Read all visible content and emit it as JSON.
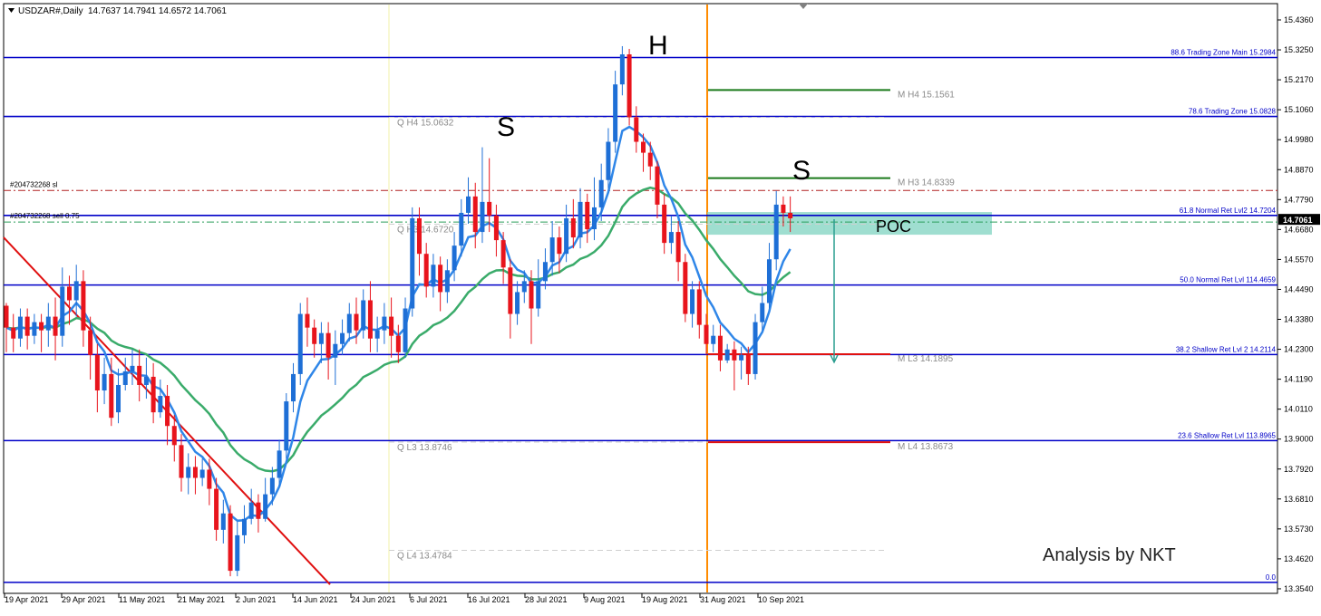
{
  "window": {
    "title": "USDZAR#,Daily",
    "ohlc": "14.7637 14.7941 14.6572 14.7061"
  },
  "annotations": {
    "watermark": "Analysis by NKT",
    "pattern_left": "S",
    "pattern_head": "H",
    "pattern_right": "S",
    "poc": "POC",
    "order_sl": "#204732268 sl",
    "order_sell": "#204732268 sell 0.75"
  },
  "colors": {
    "bull": "#1e6fd6",
    "bear": "#e8141c",
    "ma_fast": "#2f86e8",
    "ma_slow": "#3aab6a",
    "level_line": "#0000c8",
    "pivot_green": "#1a7a1a",
    "pivot_red": "#e01010",
    "vertical_marker": "#ff8c00",
    "trendline": "#e01010",
    "poc_zone": "#7fd3c0",
    "current_price_bg": "#000000"
  },
  "chart_data": {
    "type": "candlestick",
    "symbol": "USDZAR#",
    "timeframe": "Daily",
    "ylim": [
      13.354,
      15.4856
    ],
    "y_ticks": [
      "15.4360",
      "15.3250",
      "15.2170",
      "15.1060",
      "14.9980",
      "14.8870",
      "14.7790",
      "14.6680",
      "14.5570",
      "14.4490",
      "14.3380",
      "14.2300",
      "14.1190",
      "14.0110",
      "13.9000",
      "13.7920",
      "13.6810",
      "13.5730",
      "13.4620",
      "13.3540"
    ],
    "x_ticks": [
      "19 Apr 2021",
      "29 Apr 2021",
      "11 May 2021",
      "21 May 2021",
      "2 Jun 2021",
      "14 Jun 2021",
      "24 Jun 2021",
      "6 Jul 2021",
      "16 Jul 2021",
      "28 Jul 2021",
      "9 Aug 2021",
      "19 Aug 2021",
      "31 Aug 2021",
      "10 Sep 2021"
    ],
    "current_price": "14.7061",
    "fib_levels": [
      {
        "label": "88.6 Trading Zone Main 15.2984",
        "value": 15.2984
      },
      {
        "label": "78.6 Trading Zone 15.0828",
        "value": 15.0828
      },
      {
        "label": "61.8 Normal Ret Lvl2 14.7204",
        "value": 14.7204
      },
      {
        "label": "50.0 Normal Ret Lvl 114.4659",
        "value": 14.4659
      },
      {
        "label": "38.2 Shallow Ret Lvl 2 14.2114",
        "value": 14.2114
      },
      {
        "label": "23.6 Shallow Ret Lvl 113.8965",
        "value": 13.8965
      },
      {
        "label": "0.0",
        "value": 13.3776
      }
    ],
    "quarterly_pivots": [
      {
        "label": "Q  H4 15.0632",
        "value": 15.0632
      },
      {
        "label": "Q  H3 14.6720",
        "value": 14.672
      },
      {
        "label": "Q  L3 13.8746",
        "value": 13.8746
      },
      {
        "label": "Q  L4 13.4784",
        "value": 13.4784
      }
    ],
    "monthly_pivots": [
      {
        "label": "M  H4 15.1561",
        "value": 15.1561,
        "color": "green"
      },
      {
        "label": "M  H3 14.8339",
        "value": 14.8339,
        "color": "green"
      },
      {
        "label": "M  L3 14.1895",
        "value": 14.1895,
        "color": "red"
      },
      {
        "label": "M  L4 13.8673",
        "value": 13.8673,
        "color": "red"
      }
    ],
    "orders": [
      {
        "label": "#204732268 sl",
        "value": 14.8117
      },
      {
        "label": "#204732268 sell 0.75",
        "value": 14.6962
      }
    ],
    "poc_zone": [
      14.65,
      14.733
    ],
    "projection_target": 14.19,
    "candles": [
      [
        14.39,
        14.31,
        14.4,
        14.22
      ],
      [
        14.31,
        14.27,
        14.36,
        14.22
      ],
      [
        14.27,
        14.35,
        14.38,
        14.24
      ],
      [
        14.35,
        14.28,
        14.38,
        14.23
      ],
      [
        14.28,
        14.33,
        14.36,
        14.25
      ],
      [
        14.33,
        14.3,
        14.36,
        14.22
      ],
      [
        14.3,
        14.35,
        14.4,
        14.24
      ],
      [
        14.35,
        14.28,
        14.42,
        14.19
      ],
      [
        14.28,
        14.46,
        14.53,
        14.24
      ],
      [
        14.46,
        14.41,
        14.5,
        14.32
      ],
      [
        14.41,
        14.48,
        14.54,
        14.35
      ],
      [
        14.48,
        14.3,
        14.52,
        14.24
      ],
      [
        14.3,
        14.21,
        14.35,
        14.12
      ],
      [
        14.21,
        14.08,
        14.25,
        14.0
      ],
      [
        14.08,
        14.14,
        14.2,
        14.03
      ],
      [
        14.14,
        13.98,
        14.2,
        13.95
      ],
      [
        14.0,
        14.1,
        14.16,
        13.96
      ],
      [
        14.1,
        14.15,
        14.2,
        14.08
      ],
      [
        14.15,
        14.17,
        14.23,
        14.1
      ],
      [
        14.17,
        14.1,
        14.23,
        14.04
      ],
      [
        14.1,
        14.13,
        14.2,
        14.05
      ],
      [
        14.13,
        14.0,
        14.18,
        13.96
      ],
      [
        14.0,
        14.06,
        14.12,
        13.98
      ],
      [
        14.06,
        13.95,
        14.1,
        13.88
      ],
      [
        13.95,
        13.88,
        13.99,
        13.82
      ],
      [
        13.88,
        13.76,
        13.92,
        13.71
      ],
      [
        13.76,
        13.8,
        13.85,
        13.7
      ],
      [
        13.8,
        13.76,
        13.84,
        13.7
      ],
      [
        13.76,
        13.79,
        13.83,
        13.73
      ],
      [
        13.79,
        13.72,
        13.83,
        13.66
      ],
      [
        13.72,
        13.57,
        13.76,
        13.53
      ],
      [
        13.57,
        13.63,
        13.68,
        13.52
      ],
      [
        13.63,
        13.42,
        13.66,
        13.4
      ],
      [
        13.42,
        13.55,
        13.6,
        13.4
      ],
      [
        13.55,
        13.61,
        13.66,
        13.52
      ],
      [
        13.61,
        13.67,
        13.72,
        13.59
      ],
      [
        13.67,
        13.61,
        13.7,
        13.56
      ],
      [
        13.61,
        13.7,
        13.76,
        13.6
      ],
      [
        13.7,
        13.76,
        13.8,
        13.66
      ],
      [
        13.76,
        13.86,
        13.9,
        13.73
      ],
      [
        13.86,
        14.04,
        14.07,
        13.83
      ],
      [
        14.04,
        14.14,
        14.18,
        14.0
      ],
      [
        14.14,
        14.36,
        14.4,
        14.1
      ],
      [
        14.36,
        14.31,
        14.42,
        14.24
      ],
      [
        14.31,
        14.25,
        14.34,
        14.2
      ],
      [
        14.25,
        14.29,
        14.33,
        14.18
      ],
      [
        14.29,
        14.2,
        14.33,
        14.12
      ],
      [
        14.2,
        14.25,
        14.3,
        14.1
      ],
      [
        14.25,
        14.29,
        14.34,
        14.21
      ],
      [
        14.29,
        14.36,
        14.4,
        14.26
      ],
      [
        14.36,
        14.3,
        14.42,
        14.25
      ],
      [
        14.3,
        14.41,
        14.45,
        14.27
      ],
      [
        14.41,
        14.27,
        14.48,
        14.22
      ],
      [
        14.27,
        14.3,
        14.35,
        14.22
      ],
      [
        14.3,
        14.35,
        14.4,
        14.25
      ],
      [
        14.35,
        14.28,
        14.42,
        14.2
      ],
      [
        14.28,
        14.22,
        14.32,
        14.18
      ],
      [
        14.22,
        14.38,
        14.42,
        14.2
      ],
      [
        14.38,
        14.71,
        14.75,
        14.35
      ],
      [
        14.71,
        14.58,
        14.75,
        14.5
      ],
      [
        14.58,
        14.46,
        14.62,
        14.42
      ],
      [
        14.46,
        14.54,
        14.58,
        14.42
      ],
      [
        14.54,
        14.44,
        14.57,
        14.37
      ],
      [
        14.44,
        14.52,
        14.56,
        14.4
      ],
      [
        14.52,
        14.61,
        14.66,
        14.48
      ],
      [
        14.61,
        14.73,
        14.78,
        14.57
      ],
      [
        14.73,
        14.79,
        14.86,
        14.69
      ],
      [
        14.79,
        14.66,
        14.84,
        14.6
      ],
      [
        14.66,
        14.77,
        14.97,
        14.62
      ],
      [
        14.77,
        14.72,
        14.93,
        14.66
      ],
      [
        14.72,
        14.63,
        14.76,
        14.57
      ],
      [
        14.63,
        14.53,
        14.66,
        14.47
      ],
      [
        14.53,
        14.36,
        14.56,
        14.27
      ],
      [
        14.36,
        14.44,
        14.48,
        14.32
      ],
      [
        14.44,
        14.48,
        14.52,
        14.4
      ],
      [
        14.48,
        14.38,
        14.52,
        14.25
      ],
      [
        14.38,
        14.48,
        14.56,
        14.35
      ],
      [
        14.48,
        14.55,
        14.6,
        14.45
      ],
      [
        14.55,
        14.64,
        14.7,
        14.5
      ],
      [
        14.64,
        14.58,
        14.68,
        14.51
      ],
      [
        14.58,
        14.71,
        14.76,
        14.55
      ],
      [
        14.71,
        14.64,
        14.78,
        14.6
      ],
      [
        14.64,
        14.77,
        14.82,
        14.6
      ],
      [
        14.77,
        14.67,
        14.8,
        14.62
      ],
      [
        14.67,
        14.75,
        14.86,
        14.63
      ],
      [
        14.75,
        14.85,
        14.91,
        14.7
      ],
      [
        14.85,
        14.99,
        15.04,
        14.82
      ],
      [
        14.99,
        15.2,
        15.25,
        14.95
      ],
      [
        15.2,
        15.31,
        15.34,
        15.16
      ],
      [
        15.31,
        15.08,
        15.33,
        15.05
      ],
      [
        15.08,
        14.99,
        15.12,
        14.95
      ],
      [
        14.99,
        14.95,
        15.02,
        14.88
      ],
      [
        14.95,
        14.9,
        14.99,
        14.85
      ],
      [
        14.9,
        14.76,
        14.92,
        14.71
      ],
      [
        14.76,
        14.62,
        14.8,
        14.58
      ],
      [
        14.62,
        14.66,
        14.72,
        14.58
      ],
      [
        14.66,
        14.55,
        14.7,
        14.48
      ],
      [
        14.55,
        14.36,
        14.58,
        14.33
      ],
      [
        14.36,
        14.45,
        14.48,
        14.31
      ],
      [
        14.45,
        14.32,
        14.48,
        14.27
      ],
      [
        14.32,
        14.25,
        14.36,
        14.21
      ],
      [
        14.25,
        14.28,
        14.32,
        14.22
      ],
      [
        14.28,
        14.19,
        14.32,
        14.15
      ],
      [
        14.19,
        14.23,
        14.25,
        14.18
      ],
      [
        14.23,
        14.19,
        14.26,
        14.08
      ],
      [
        14.19,
        14.21,
        14.24,
        14.12
      ],
      [
        14.21,
        14.14,
        14.24,
        14.1
      ],
      [
        14.14,
        14.33,
        14.36,
        14.12
      ],
      [
        14.33,
        14.4,
        14.46,
        14.3
      ],
      [
        14.4,
        14.56,
        14.62,
        14.38
      ],
      [
        14.56,
        14.76,
        14.81,
        14.52
      ],
      [
        14.76,
        14.73,
        14.79,
        14.68
      ],
      [
        14.73,
        14.71,
        14.79,
        14.66
      ]
    ]
  }
}
